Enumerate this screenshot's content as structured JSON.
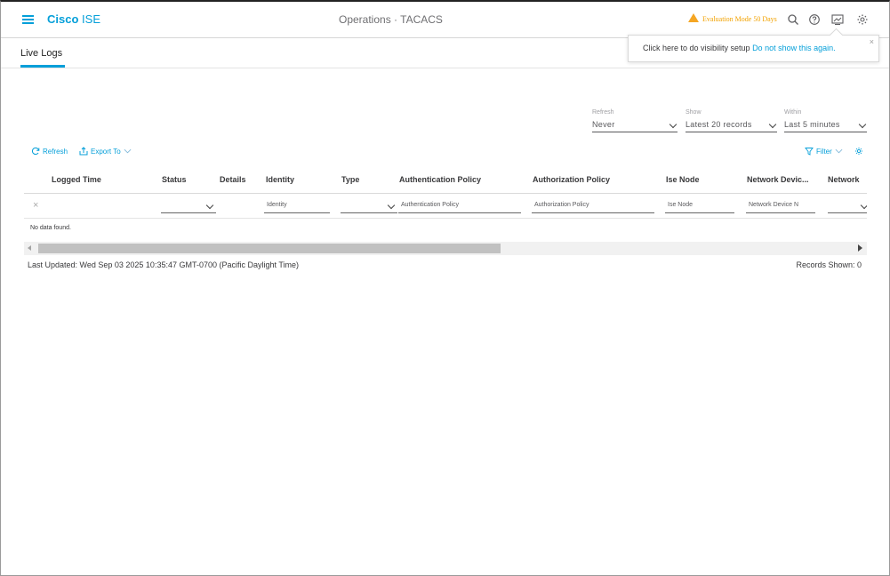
{
  "header": {
    "brand_bold": "Cisco",
    "brand_light": "ISE",
    "title": "Operations · TACACS",
    "evaluation": "Evaluation Mode 50 Days"
  },
  "subheader": {
    "tab": "Live Logs"
  },
  "popup": {
    "message": "Click here to do visibility setup ",
    "link": "Do not show this again.",
    "close": "×"
  },
  "filters": {
    "refresh": {
      "label": "Refresh",
      "value": "Never"
    },
    "show": {
      "label": "Show",
      "value": "Latest 20 records"
    },
    "within": {
      "label": "Within",
      "value": "Last 5 minutes"
    }
  },
  "toolbar": {
    "refresh": "Refresh",
    "export": "Export To",
    "filter": "Filter"
  },
  "table": {
    "columns": {
      "logged_time": "Logged Time",
      "status": "Status",
      "details": "Details",
      "identity": "Identity",
      "type": "Type",
      "auth_policy": "Authentication Policy",
      "authz_policy": "Authorization Policy",
      "ise_node": "Ise Node",
      "network_device": "Network Devic...",
      "network_more": "Network"
    },
    "filter_placeholders": {
      "identity": "Identity",
      "auth_policy": "Authentication Policy",
      "authz_policy": "Authorization Policy",
      "ise_node": "Ise Node",
      "network_device": "Network Device N"
    },
    "clear": "×",
    "empty": "No data found."
  },
  "footer": {
    "last_updated": "Last Updated: Wed Sep 03 2025 10:35:47 GMT-0700 (Pacific Daylight Time)",
    "records": "Records Shown: 0"
  },
  "colors": {
    "accent": "#049fd9",
    "warning": "#f5a623"
  }
}
